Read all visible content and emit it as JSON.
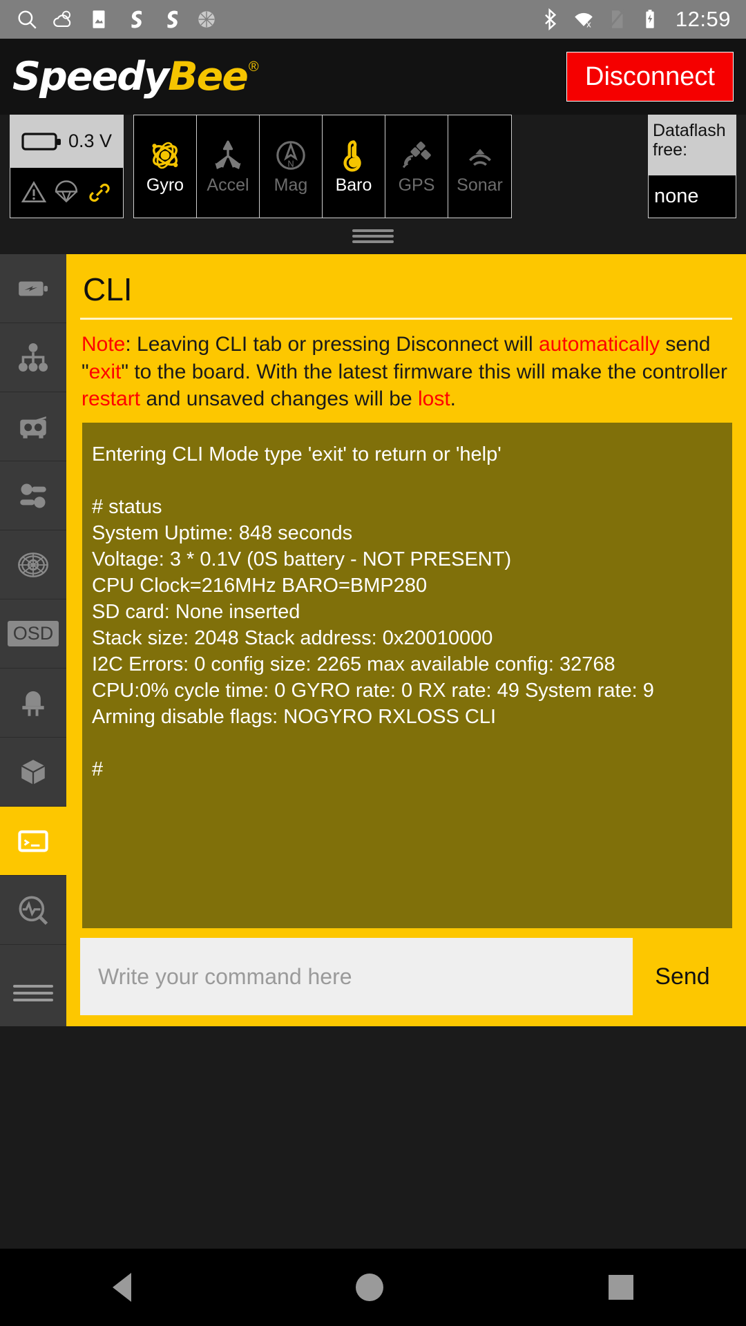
{
  "statusbar": {
    "icons": [
      "search-icon",
      "weather-icon",
      "gallery-icon",
      "sync-icon",
      "sync-icon-2",
      "brightness-icon"
    ],
    "right_icons": [
      "bluetooth-icon",
      "wifi-off-icon",
      "sim-off-icon",
      "battery-charging-icon"
    ],
    "clock": "12:59"
  },
  "header": {
    "logo_part1": "Speedy",
    "logo_part2": "Bee",
    "registered_mark": "®",
    "disconnect_label": "Disconnect",
    "disconnect_color": "#f50000"
  },
  "sensorbar": {
    "battery": {
      "voltage": "0.3 V",
      "icons": [
        "warning-icon",
        "parachute-icon",
        "link-icon"
      ]
    },
    "sensors": [
      {
        "label": "Gyro",
        "state": "on",
        "icon": "gyro-icon"
      },
      {
        "label": "Accel",
        "state": "off",
        "icon": "accel-icon"
      },
      {
        "label": "Mag",
        "state": "off",
        "icon": "compass-icon"
      },
      {
        "label": "Baro",
        "state": "on",
        "icon": "thermometer-icon"
      },
      {
        "label": "GPS",
        "state": "off",
        "icon": "satellite-icon"
      },
      {
        "label": "Sonar",
        "state": "off",
        "icon": "sonar-icon"
      }
    ],
    "dataflash": {
      "title": "Dataflash free:",
      "value": "none"
    },
    "active_color": "#f5c400",
    "inactive_color": "#6d6d6d"
  },
  "sidebar": {
    "items": [
      {
        "name": "power",
        "icon": "battery-bolt-icon",
        "active": false
      },
      {
        "name": "ports",
        "icon": "sitemap-icon",
        "active": false
      },
      {
        "name": "receiver",
        "icon": "rc-transmitter-icon",
        "active": false
      },
      {
        "name": "modes",
        "icon": "toggles-icon",
        "active": false
      },
      {
        "name": "motors",
        "icon": "propeller-icon",
        "active": false
      },
      {
        "name": "osd",
        "icon": "osd-icon",
        "active": false
      },
      {
        "name": "led",
        "icon": "led-icon",
        "active": false
      },
      {
        "name": "blackbox",
        "icon": "cube-icon",
        "active": false
      },
      {
        "name": "cli",
        "icon": "terminal-icon",
        "active": true
      },
      {
        "name": "sensors",
        "icon": "pulse-search-icon",
        "active": false
      }
    ],
    "osd_label": "OSD",
    "active_color": "#fdc700"
  },
  "cli": {
    "title": "CLI",
    "note_segments": [
      {
        "t": "Note",
        "red": true
      },
      {
        "t": ": Leaving CLI tab or pressing Disconnect will ",
        "red": false
      },
      {
        "t": "automatically",
        "red": true
      },
      {
        "t": " send \"",
        "red": false
      },
      {
        "t": "exit",
        "red": true
      },
      {
        "t": "\" to the board.  With the latest firmware this will make the controller ",
        "red": false
      },
      {
        "t": "restart",
        "red": true
      },
      {
        "t": " and unsaved changes will be ",
        "red": false
      },
      {
        "t": "lost",
        "red": true
      },
      {
        "t": ".",
        "red": false
      }
    ],
    "terminal_lines": [
      "Entering CLI Mode type 'exit' to return or 'help'",
      "",
      "# status",
      "System Uptime: 848 seconds",
      "Voltage: 3 * 0.1V (0S battery - NOT PRESENT)",
      "CPU Clock=216MHz BARO=BMP280",
      "SD card: None inserted",
      "Stack size: 2048 Stack address: 0x20010000",
      "I2C Errors: 0 config size: 2265 max available config: 32768",
      "CPU:0% cycle time: 0 GYRO rate: 0 RX rate: 49 System rate: 9",
      "Arming disable flags: NOGYRO RXLOSS CLI",
      "",
      "#"
    ],
    "terminal_bg": "#80700a",
    "input_placeholder": "Write your command here",
    "input_value": "",
    "send_label": "Send"
  },
  "navbar": {
    "items": [
      "back-button",
      "home-button",
      "recents-button"
    ]
  }
}
